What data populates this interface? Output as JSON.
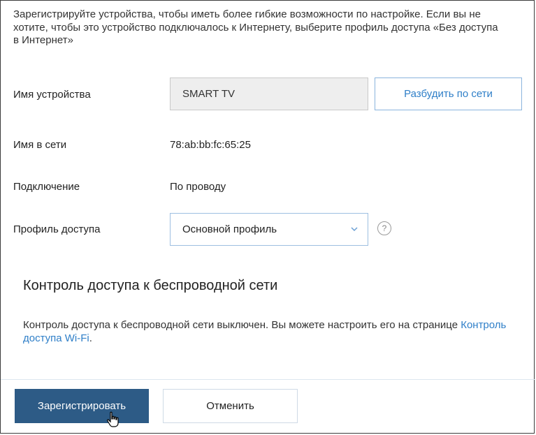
{
  "intro_text": "Зарегистрируйте устройства, чтобы иметь более гибкие возможности по настройке. Если вы не хотите, чтобы это устройство подключалось к Интернету, выберите профиль доступа «Без доступа в Интернет»",
  "device_name": {
    "label": "Имя устройства",
    "value": "SMART TV",
    "wake_button": "Разбудить по сети"
  },
  "network_name": {
    "label": "Имя в сети",
    "value": "78:ab:bb:fc:65:25"
  },
  "connection": {
    "label": "Подключение",
    "value": "По проводу"
  },
  "access_profile": {
    "label": "Профиль доступа",
    "selected": "Основной профиль",
    "help": "?"
  },
  "wireless": {
    "title": "Контроль доступа к беспроводной сети",
    "text": "Контроль доступа к беспроводной сети выключен. Вы можете настроить его на странице ",
    "link": "Контроль доступа Wi-Fi",
    "suffix": "."
  },
  "footer": {
    "register": "Зарегистрировать",
    "cancel": "Отменить"
  },
  "colors": {
    "primary": "#2d5b86",
    "link": "#2f7fc8"
  },
  "icons": {
    "select_arrow": "chevron-down-icon",
    "help": "question-icon",
    "pointer": "hand-cursor-icon"
  }
}
